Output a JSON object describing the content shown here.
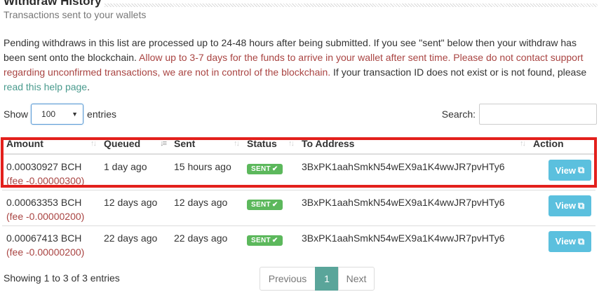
{
  "header": {
    "title": "Withdraw History",
    "subtitle": "Transactions sent to your wallets"
  },
  "notice": {
    "normal_1": "Pending withdraws in this list are processed up to 24-48 hours after being submitted. If you see \"sent\" below then your withdraw has been sent onto the blockchain. ",
    "warning": "Allow up to 3-7 days for the funds to arrive in your wallet after sent time. Please do not contact support regarding unconfirmed transactions, we are not in control of the blockchain.",
    "normal_2": " If your transaction ID does not exist or is not found, please ",
    "link": "read this help page",
    "period": "."
  },
  "length": {
    "show_label": "Show",
    "selected": "100",
    "entries_label": "entries"
  },
  "search": {
    "label": "Search:",
    "value": ""
  },
  "table": {
    "columns": [
      "Amount",
      "Queued",
      "Sent",
      "Status",
      "To Address",
      "Action"
    ],
    "rows": [
      {
        "amount": "0.00030927 BCH",
        "fee": "(fee -0.00000300)",
        "queued": "1 day ago",
        "sent": "15 hours ago",
        "status": "SENT",
        "address": "3BxPK1aahSmkN54wEX9a1K4wwJR7pvHTy6",
        "action": "View"
      },
      {
        "amount": "0.00063353 BCH",
        "fee": "(fee -0.00000200)",
        "queued": "12 days ago",
        "sent": "12 days ago",
        "status": "SENT",
        "address": "3BxPK1aahSmkN54wEX9a1K4wwJR7pvHTy6",
        "action": "View"
      },
      {
        "amount": "0.00067413 BCH",
        "fee": "(fee -0.00000200)",
        "queued": "22 days ago",
        "sent": "22 days ago",
        "status": "SENT",
        "address": "3BxPK1aahSmkN54wEX9a1K4wwJR7pvHTy6",
        "action": "View"
      }
    ],
    "sort_icons": {
      "default": "sort-icon",
      "active": "sort-amount-desc-icon"
    }
  },
  "footer": {
    "info": "Showing 1 to 3 of 3 entries",
    "previous": "Previous",
    "current_page": "1",
    "next": "Next"
  },
  "colors": {
    "accent": "#5aa59a",
    "warning_text": "#a94442",
    "status_sent": "#5cb85c",
    "view_button": "#5bc0de",
    "highlight_box": "#e3201c"
  }
}
